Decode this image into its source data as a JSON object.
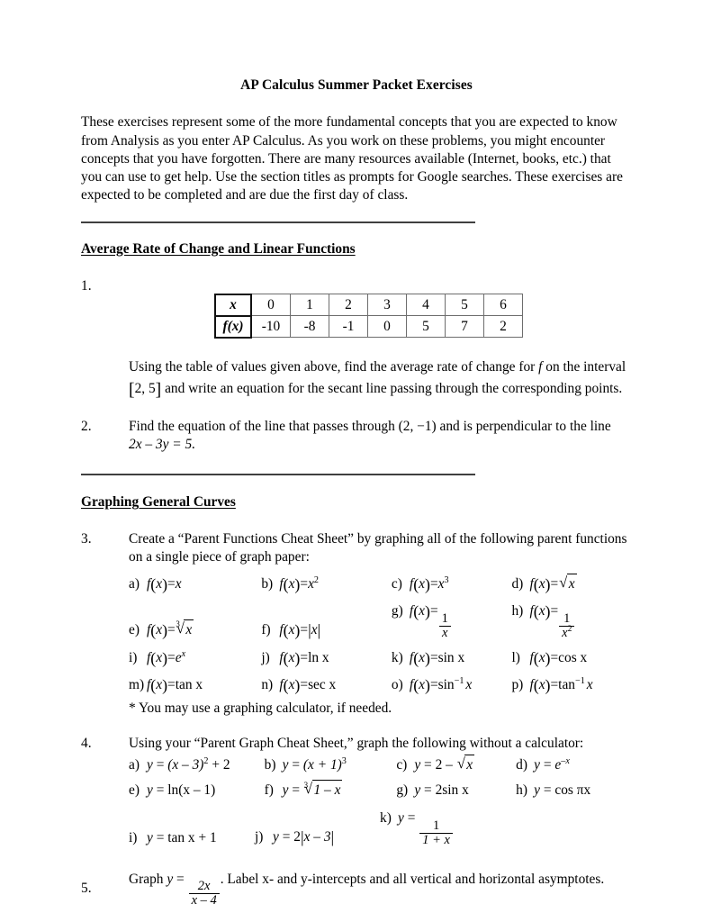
{
  "document": {
    "title": "AP Calculus Summer Packet Exercises",
    "intro": "These exercises represent some of the more fundamental concepts that you are expected to know from Analysis as you enter AP Calculus.  As you work on these problems, you might encounter concepts that you have forgotten.  There are many resources available (Internet, books, etc.) that you can use to get help. Use the section titles as prompts for Google searches. These exercises are expected to be completed and are due the first day of class."
  },
  "sections": [
    {
      "heading": "Average Rate of Change and Linear Functions"
    },
    {
      "heading": "Graphing General Curves"
    }
  ],
  "table": {
    "row_labels": [
      "x",
      "f(x)"
    ],
    "x_values": [
      "0",
      "1",
      "2",
      "3",
      "4",
      "5",
      "6"
    ],
    "fx_values": [
      "-10",
      "-8",
      "-1",
      "0",
      "5",
      "7",
      "2"
    ]
  },
  "items": {
    "q1": {
      "number": "1.",
      "text_a": "Using the table of values given above, find the average rate of change for ",
      "text_f": "f",
      "text_b": " on the interval ",
      "interval_open": "[",
      "interval_value": "2, 5",
      "interval_close": "]",
      "text_c": " and write an equation for the secant line passing through the corresponding points."
    },
    "q2": {
      "number": "2.",
      "line1_a": "Find the equation of the line that passes through (2, ",
      "line1_minus": "−1",
      "line1_b": ") and is perpendicular to the line",
      "line2_eq": "2x – 3y = 5."
    },
    "q3": {
      "number": "3.",
      "line1": "Create a “Parent Functions Cheat Sheet” by graphing all of the following parent functions",
      "line2": "on a single piece of graph paper:",
      "note": "* You may use a graphing calculator, if needed.",
      "labels": [
        "a)",
        "b)",
        "c)",
        "d)",
        "e)",
        "f)",
        "g)",
        "h)",
        "i)",
        "j)",
        "k)",
        "l)",
        "m)",
        "n)",
        "o)",
        "p)"
      ],
      "fx_prefix": "f",
      "paren_open": "(",
      "var": "x",
      "paren_close": ")",
      "equals": "=",
      "expr": {
        "a": "x",
        "b": "x",
        "b_exp": "2",
        "c": "x",
        "c_exp": "3",
        "d_radicand": "x",
        "e_index": "3",
        "e_radicand": "x",
        "f": "x",
        "g_num": "1",
        "g_den": "x",
        "h_num": "1",
        "h_den": "x",
        "h_den_exp": "2",
        "i": "e",
        "i_exp": "x",
        "j": "ln x",
        "k": "sin x",
        "l": "cos x",
        "m": "tan x",
        "n": "sec x",
        "o_fn": "sin",
        "o_exp": "−1",
        "o_arg": "x",
        "p_fn": "tan",
        "p_exp": "−1",
        "p_arg": "x"
      }
    },
    "q4": {
      "number": "4.",
      "line1": "Using your “Parent Graph Cheat Sheet,” graph the following without a calculator:",
      "labels": [
        "a)",
        "b)",
        "c)",
        "d)",
        "e)",
        "f)",
        "g)",
        "h)",
        "i)",
        "j)",
        "k)"
      ],
      "y": "y",
      "equals": "=",
      "expr": {
        "a": "(x – 3)",
        "a_exp": "2",
        "a_tail": " + 2",
        "b": "(x + 1)",
        "b_exp": "3",
        "c_lead": "2 – ",
        "c_radicand": "x",
        "d": "e",
        "d_exp": "–x",
        "e": "ln(x – 1)",
        "f_index": "3",
        "f_radicand": "1 – x",
        "g": "2sin x",
        "h": "cos πx",
        "i": "tan x + 1",
        "j_lead": "2",
        "j_arg": "x – 3",
        "k_num": "1",
        "k_den": "1 + x"
      }
    },
    "q5": {
      "number": "5.",
      "lead": "Graph  ",
      "y": "y",
      "equals": "=",
      "num": "2x",
      "den": "x – 4",
      "tail": ". Label x- and y-intercepts and all vertical and horizontal asymptotes."
    }
  }
}
